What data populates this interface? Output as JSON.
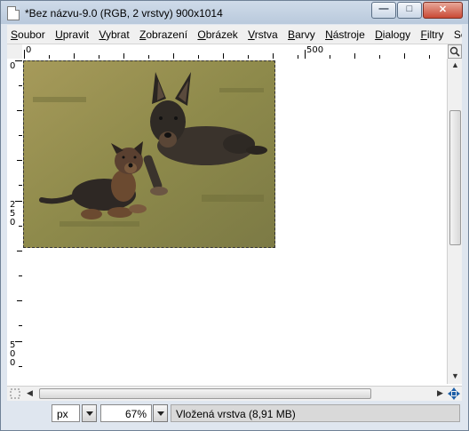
{
  "window": {
    "title": "*Bez názvu-9.0 (RGB, 2 vrstvy) 900x1014",
    "controls": {
      "minimize": "—",
      "maximize": "□",
      "close": "✕"
    }
  },
  "menubar": {
    "items": [
      {
        "label": "Soubor",
        "key": "S"
      },
      {
        "label": "Upravit",
        "key": "U"
      },
      {
        "label": "Vybrat",
        "key": "V"
      },
      {
        "label": "Zobrazení",
        "key": "Z"
      },
      {
        "label": "Obrázek",
        "key": "O"
      },
      {
        "label": "Vrstva",
        "key": "V"
      },
      {
        "label": "Barvy",
        "key": "B"
      },
      {
        "label": "Nástroje",
        "key": "N"
      },
      {
        "label": "Dialogy",
        "key": "D"
      },
      {
        "label": "Filtry",
        "key": "F"
      },
      {
        "label": "Scr",
        "key": ""
      }
    ]
  },
  "rulers": {
    "horizontal_labels": [
      "0",
      "500"
    ],
    "vertical_labels": [
      "0",
      "250",
      "500"
    ]
  },
  "canvas": {
    "image_description": "photo of an adult German Shepherd lying on grass with a puppy",
    "colors": {
      "grass": "#8c8a4a",
      "dog": "#2f2a25"
    }
  },
  "statusbar": {
    "unit": "px",
    "zoom": "67%",
    "layer_info": "Vložená vrstva (8,91 MB)"
  }
}
